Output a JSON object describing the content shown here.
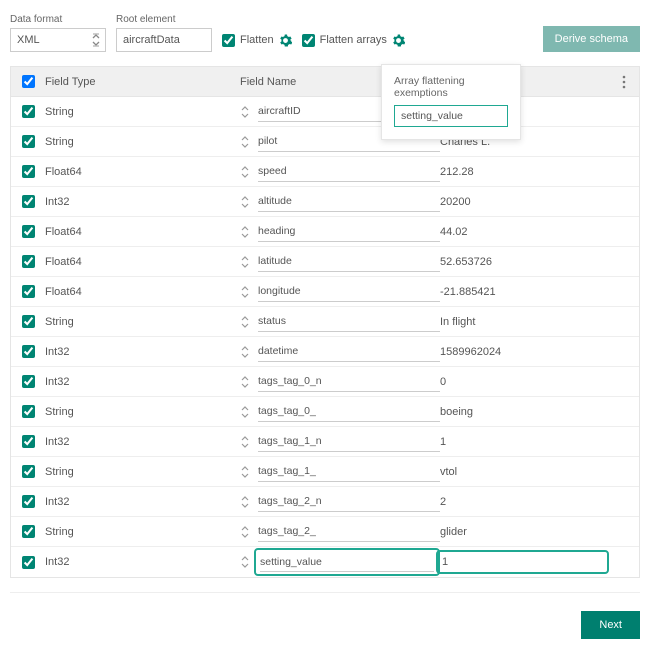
{
  "labels": {
    "dataFormat": "Data format",
    "rootElement": "Root element",
    "flatten": "Flatten",
    "flattenArrays": "Flatten arrays",
    "deriveSchema": "Derive schema",
    "fieldType": "Field Type",
    "fieldName": "Field Name",
    "next": "Next"
  },
  "top": {
    "dataFormatValue": "XML",
    "rootElementValue": "aircraftData"
  },
  "popover": {
    "title": "Array flattening exemptions",
    "value": "setting_value"
  },
  "rows": [
    {
      "type": "String",
      "name": "aircraftID",
      "sample": ""
    },
    {
      "type": "String",
      "name": "pilot",
      "sample": "Charles L."
    },
    {
      "type": "Float64",
      "name": "speed",
      "sample": "212.28"
    },
    {
      "type": "Int32",
      "name": "altitude",
      "sample": "20200"
    },
    {
      "type": "Float64",
      "name": "heading",
      "sample": "44.02"
    },
    {
      "type": "Float64",
      "name": "latitude",
      "sample": "52.653726"
    },
    {
      "type": "Float64",
      "name": "longitude",
      "sample": "-21.885421"
    },
    {
      "type": "String",
      "name": "status",
      "sample": "In flight"
    },
    {
      "type": "Int32",
      "name": "datetime",
      "sample": "1589962024"
    },
    {
      "type": "Int32",
      "name": "tags_tag_0_n",
      "sample": "0"
    },
    {
      "type": "String",
      "name": "tags_tag_0_",
      "sample": "boeing"
    },
    {
      "type": "Int32",
      "name": "tags_tag_1_n",
      "sample": "1"
    },
    {
      "type": "String",
      "name": "tags_tag_1_",
      "sample": "vtol"
    },
    {
      "type": "Int32",
      "name": "tags_tag_2_n",
      "sample": "2"
    },
    {
      "type": "String",
      "name": "tags_tag_2_",
      "sample": "glider"
    },
    {
      "type": "Int32",
      "name": "setting_value",
      "sample": "1"
    }
  ]
}
